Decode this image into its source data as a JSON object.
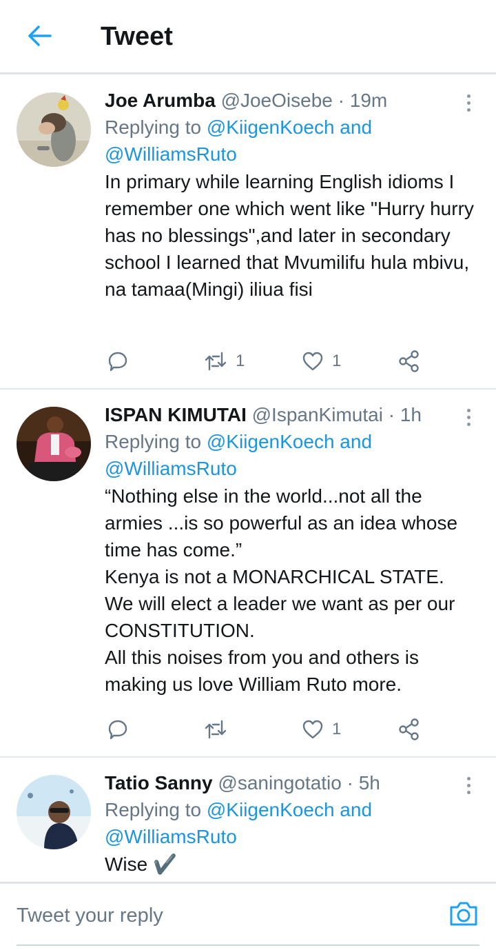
{
  "header": {
    "title": "Tweet",
    "back_icon": "arrow-left-icon"
  },
  "colors": {
    "accent": "#1da1f2",
    "link": "#1b95e0",
    "muted": "#657786",
    "text": "#14171a",
    "divider": "#e1e8ed"
  },
  "tweets": [
    {
      "name": "Joe Arumba",
      "handle": "@JoeOisebe",
      "dot": "·",
      "time": "19m",
      "replying_prefix": "Replying to ",
      "mention1": "@KiigenKoech",
      "joiner": " and",
      "mention2": "@WilliamsRuto",
      "lines": [
        "In primary while learning English idioms I remember one which went like \"Hurry hurry has no blessings\",and later in secondary school I learned that Mvumilifu hula mbivu, na tamaa(Mingi) iliua fisi"
      ],
      "retweets": "1",
      "likes": "1"
    },
    {
      "name": "ISPAN KIMUTAI",
      "handle": "@IspanKimutai",
      "dot": "·",
      "time": "1h",
      "replying_prefix": "Replying to ",
      "mention1": "@KiigenKoech",
      "joiner": " and",
      "mention2": "@WilliamsRuto",
      "lines": [
        "“Nothing else in the world...not all the armies ...is so powerful as an idea whose time has come.”",
        "Kenya is not a MONARCHICAL STATE.",
        "We will elect a leader we want as per our CONSTITUTION.",
        "All this noises from you and others is making us love William Ruto more."
      ],
      "retweets": "",
      "likes": "1"
    },
    {
      "name": "Tatio Sanny",
      "handle": "@saningotatio",
      "dot": "·",
      "time": "5h",
      "replying_prefix": "Replying to ",
      "mention1": "@KiigenKoech",
      "joiner": " and",
      "mention2": "@WilliamsRuto",
      "lines": [
        "Wise ✔️"
      ]
    }
  ],
  "composer": {
    "placeholder": "Tweet your reply",
    "camera_icon": "camera-icon"
  }
}
